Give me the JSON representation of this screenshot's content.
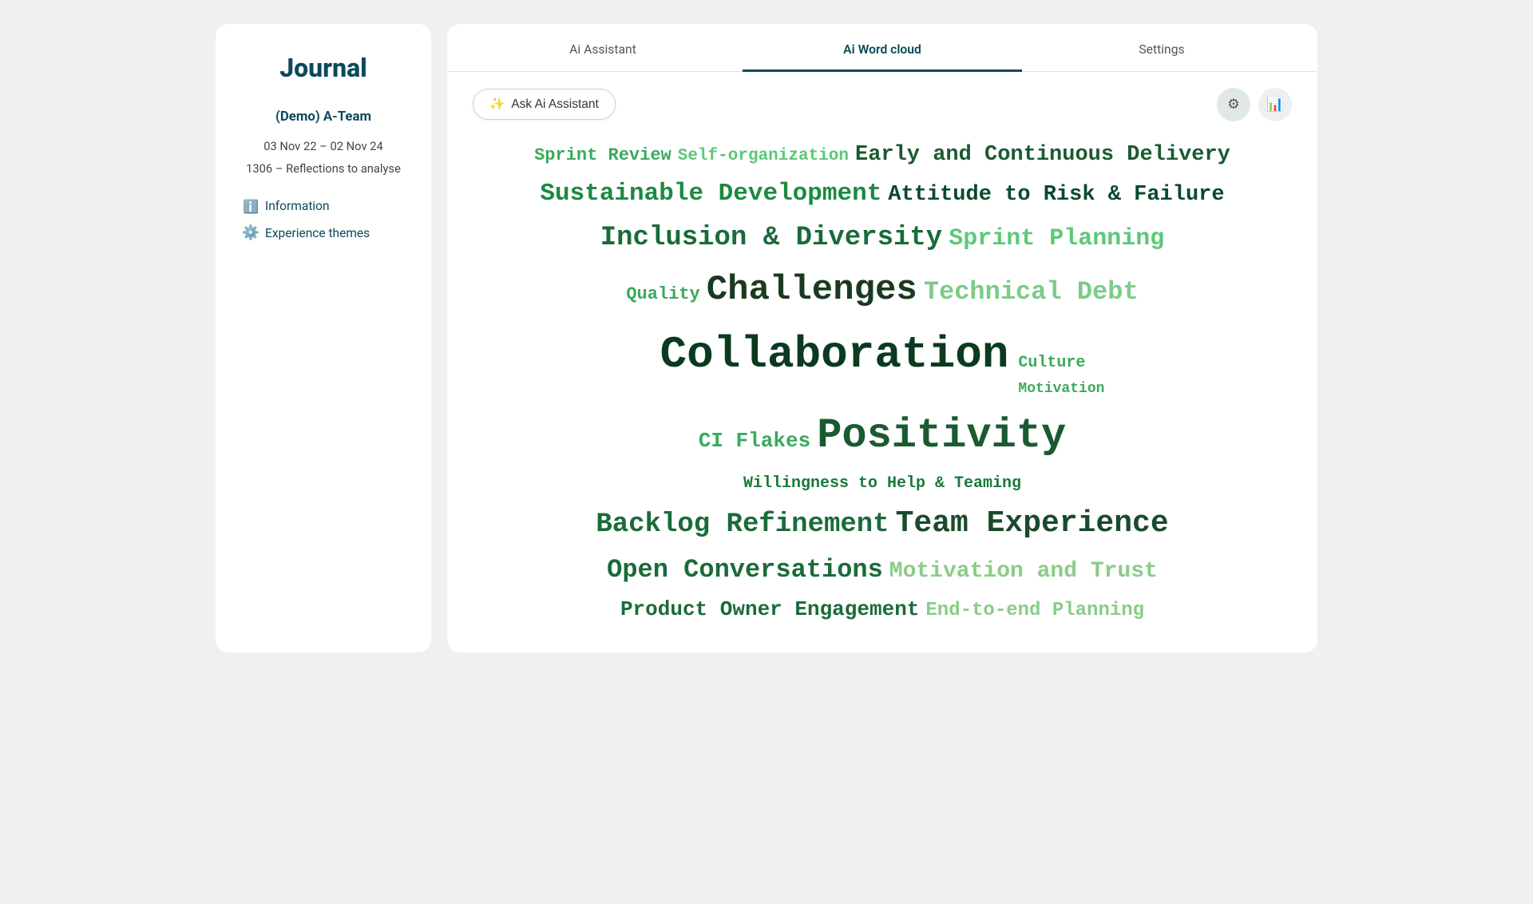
{
  "sidebar": {
    "title": "Journal",
    "team": "(Demo) A-Team",
    "dates": "03 Nov 22 – 02 Nov 24",
    "reflections": "1306 – Reflections to analyse",
    "menu": [
      {
        "id": "information",
        "label": "Information",
        "icon": "ℹ️"
      },
      {
        "id": "experience-themes",
        "label": "Experience themes",
        "icon": "⚙️"
      }
    ]
  },
  "tabs": [
    {
      "id": "ai-assistant",
      "label": "Ai Assistant",
      "active": false
    },
    {
      "id": "ai-word-cloud",
      "label": "Ai Word cloud",
      "active": true
    },
    {
      "id": "settings",
      "label": "Settings",
      "active": false
    }
  ],
  "toolbar": {
    "ask_ai_label": "Ask Ai Assistant",
    "filter_icon": "⚙",
    "chart_icon": "📊"
  },
  "word_cloud": {
    "words": [
      {
        "text": "Sprint Review",
        "size": 22,
        "color": "#3aaa5c",
        "weight": "bold"
      },
      {
        "text": "Self-organization",
        "size": 21,
        "color": "#5cc878",
        "weight": "bold"
      },
      {
        "text": "Early and Continuous Delivery",
        "size": 28,
        "color": "#1a6b3a",
        "weight": "bold"
      },
      {
        "text": "Sustainable Development",
        "size": 30,
        "color": "#1a8a40",
        "weight": "bold"
      },
      {
        "text": "Attitude to Risk & Failure",
        "size": 28,
        "color": "#0a4a2a",
        "weight": "bold"
      },
      {
        "text": "Inclusion & Diversity",
        "size": 34,
        "color": "#1a6b3a",
        "weight": "bold"
      },
      {
        "text": "Sprint Planning",
        "size": 30,
        "color": "#5cc878",
        "weight": "bold"
      },
      {
        "text": "Quality",
        "size": 22,
        "color": "#3aaa5c",
        "weight": "bold"
      },
      {
        "text": "Challenges",
        "size": 40,
        "color": "#1a4a2a",
        "weight": "bold"
      },
      {
        "text": "Technical Debt",
        "size": 32,
        "color": "#7acc88",
        "weight": "bold"
      },
      {
        "text": "Collaboration",
        "size": 54,
        "color": "#0a3a20",
        "weight": "bold"
      },
      {
        "text": "Culture",
        "size": 22,
        "color": "#3aaa5c",
        "weight": "bold"
      },
      {
        "text": "Motivation",
        "size": 20,
        "color": "#3aaa5c",
        "weight": "bold"
      },
      {
        "text": "CI Flakes",
        "size": 26,
        "color": "#3aaa5c",
        "weight": "bold"
      },
      {
        "text": "Positivity",
        "size": 52,
        "color": "#1a5a30",
        "weight": "bold"
      },
      {
        "text": "Willingness to Help & Teaming",
        "size": 22,
        "color": "#1a7a3a",
        "weight": "bold"
      },
      {
        "text": "Backlog Refinement",
        "size": 34,
        "color": "#1a6b3a",
        "weight": "bold"
      },
      {
        "text": "Team Experience",
        "size": 38,
        "color": "#1a4a2a",
        "weight": "bold"
      },
      {
        "text": "Open Conversations",
        "size": 32,
        "color": "#1a6b3a",
        "weight": "bold"
      },
      {
        "text": "Motivation and Trust",
        "size": 30,
        "color": "#8acc88",
        "weight": "bold"
      },
      {
        "text": "Product Owner Engagement",
        "size": 26,
        "color": "#1a6b3a",
        "weight": "bold"
      },
      {
        "text": "End-to-end Planning",
        "size": 26,
        "color": "#8acc88",
        "weight": "bold"
      }
    ]
  }
}
